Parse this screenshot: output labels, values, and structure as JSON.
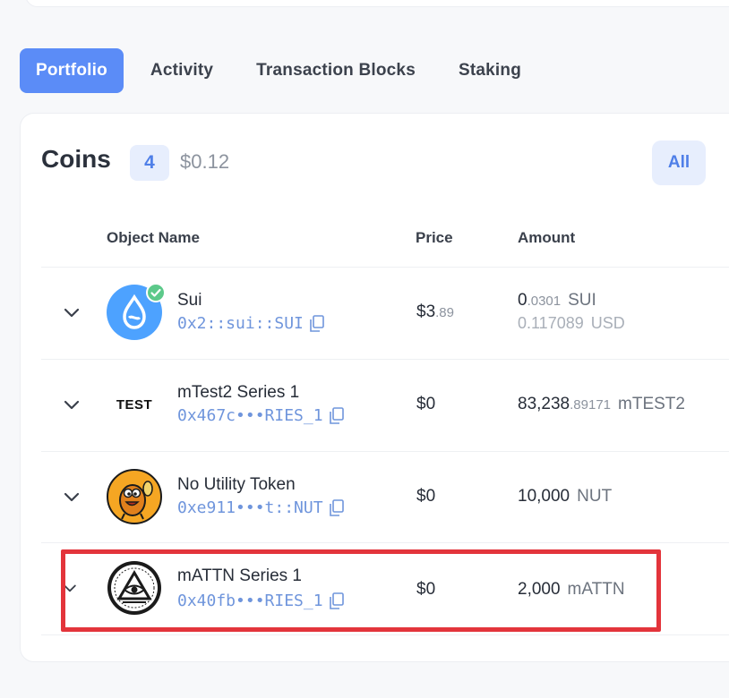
{
  "tabs": [
    {
      "label": "Portfolio",
      "active": true
    },
    {
      "label": "Activity",
      "active": false
    },
    {
      "label": "Transaction Blocks",
      "active": false
    },
    {
      "label": "Staking",
      "active": false
    }
  ],
  "coins": {
    "title": "Coins",
    "count": "4",
    "total": "$0.12",
    "filter_label": "All"
  },
  "columns": {
    "name": "Object Name",
    "price": "Price",
    "amount": "Amount"
  },
  "rows": [
    {
      "name": "Sui",
      "address": "0x2::sui::SUI",
      "price_main": "$3",
      "price_dec": ".89",
      "amount_main": "0",
      "amount_dec": ".0301",
      "unit": "SUI",
      "usd_value": "0.117089",
      "usd_unit": "USD",
      "verified": true,
      "logo": "sui-drop"
    },
    {
      "name": "mTest2 Series 1",
      "address": "0x467c•••RIES_1",
      "price_main": "$0",
      "amount_main": "83,238",
      "amount_dec": ".89171",
      "unit": "mTEST2",
      "logo_text": "TEST"
    },
    {
      "name": "No Utility Token",
      "address": "0xe911•••t::NUT",
      "price_main": "$0",
      "amount_main": "10,000",
      "unit": "NUT",
      "logo": "cartoon-character"
    },
    {
      "name": "mATTN Series 1",
      "address": "0x40fb•••RIES_1",
      "price_main": "$0",
      "amount_main": "2,000",
      "unit": "mATTN",
      "logo": "eye-pyramid-seal",
      "highlighted": true
    }
  ],
  "colors": {
    "accent": "#5b8cf7",
    "address": "#6f95dc",
    "highlight": "#e3343b",
    "verified": "#5cc98a"
  }
}
